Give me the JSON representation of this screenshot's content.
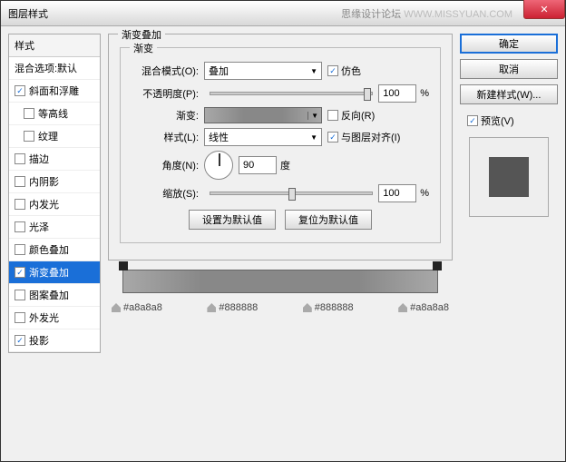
{
  "window": {
    "title": "图层样式",
    "forum": "思缘设计论坛",
    "site": "WWW.MISSYUAN.COM"
  },
  "sidebar": {
    "header": "样式",
    "blendDefault": "混合选项:默认",
    "items": [
      {
        "label": "斜面和浮雕",
        "checked": true,
        "indent": false
      },
      {
        "label": "等高线",
        "checked": false,
        "indent": true
      },
      {
        "label": "纹理",
        "checked": false,
        "indent": true
      },
      {
        "label": "描边",
        "checked": false,
        "indent": false
      },
      {
        "label": "内阴影",
        "checked": false,
        "indent": false
      },
      {
        "label": "内发光",
        "checked": false,
        "indent": false
      },
      {
        "label": "光泽",
        "checked": false,
        "indent": false
      },
      {
        "label": "颜色叠加",
        "checked": false,
        "indent": false
      },
      {
        "label": "渐变叠加",
        "checked": true,
        "indent": false,
        "selected": true
      },
      {
        "label": "图案叠加",
        "checked": false,
        "indent": false
      },
      {
        "label": "外发光",
        "checked": false,
        "indent": false
      },
      {
        "label": "投影",
        "checked": true,
        "indent": false
      }
    ]
  },
  "panel": {
    "title": "渐变叠加",
    "subtitle": "渐变",
    "blendMode": {
      "label": "混合模式(O):",
      "value": "叠加"
    },
    "dither": {
      "label": "仿色",
      "checked": true
    },
    "opacity": {
      "label": "不透明度(P):",
      "value": "100",
      "suffix": "%"
    },
    "gradient": {
      "label": "渐变:"
    },
    "reverse": {
      "label": "反向(R)",
      "checked": false
    },
    "style": {
      "label": "样式(L):",
      "value": "线性"
    },
    "align": {
      "label": "与图层对齐(I)",
      "checked": true
    },
    "angle": {
      "label": "角度(N):",
      "value": "90",
      "suffix": "度"
    },
    "scale": {
      "label": "缩放(S):",
      "value": "100",
      "suffix": "%"
    },
    "resetDefault": "设置为默认值",
    "restoreDefault": "复位为默认值"
  },
  "buttons": {
    "ok": "确定",
    "cancel": "取消",
    "newStyle": "新建样式(W)...",
    "preview": "预览(V)"
  },
  "gradient": {
    "stops": [
      {
        "pos": 0,
        "color": "#a8a8a8"
      },
      {
        "pos": 25,
        "color": "#888888"
      },
      {
        "pos": 75,
        "color": "#888888"
      },
      {
        "pos": 100,
        "color": "#a8a8a8"
      }
    ]
  }
}
